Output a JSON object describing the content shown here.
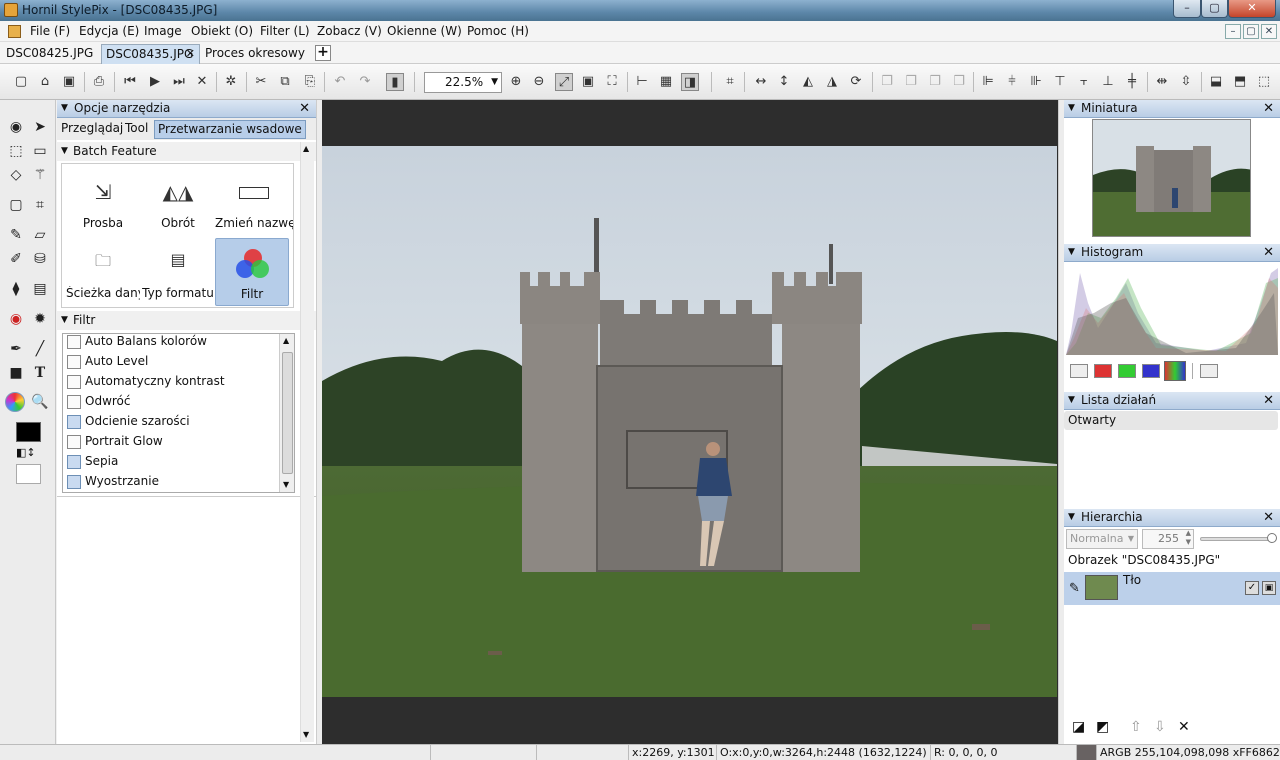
{
  "window": {
    "title": "Hornil StylePix - [DSC08435.JPG]",
    "buttons": [
      "–",
      "▢",
      "✕"
    ]
  },
  "menu": [
    "File (F)",
    "Edycja (E)",
    "Image",
    "Obiekt (O)",
    "Filter (L)",
    "Zobacz (V)",
    "Okienne (W)",
    "Pomoc (H)"
  ],
  "doc_tabs": [
    {
      "label": "DSC08425.JPG",
      "active": false
    },
    {
      "label": "DSC08435.JPG",
      "active": true,
      "close": "✕"
    },
    {
      "label": "Proces okresowy",
      "active": false
    }
  ],
  "add_tab": "+",
  "zoom": {
    "value": "22.5%"
  },
  "tool_options": {
    "title": "Opcje narzędzia",
    "close": "✕",
    "tabs": [
      {
        "label": "Przeglądaj",
        "active": false
      },
      {
        "label": "Tool",
        "active": false
      },
      {
        "label": "Przetwarzanie wsadowe",
        "active": true
      }
    ],
    "batch_header": "Batch Feature",
    "features": [
      {
        "label": "Prosba",
        "icon": "resize-icon",
        "selected": false
      },
      {
        "label": "Obrót",
        "icon": "rotate-icon",
        "selected": false
      },
      {
        "label": "Zmień nazwę",
        "icon": "rename-icon",
        "selected": false
      },
      {
        "label": "Ścieżka dany...",
        "icon": "folder-icon",
        "selected": false
      },
      {
        "label": "Typ formatu",
        "icon": "format-icon",
        "selected": false
      },
      {
        "label": "Filtr",
        "icon": "rgb-filter-icon",
        "selected": true
      }
    ],
    "filter_header": "Filtr",
    "filters": [
      {
        "label": "Auto Balans kolorów",
        "checked": false
      },
      {
        "label": "Auto Level",
        "checked": false
      },
      {
        "label": "Automatyczny kontrast",
        "checked": false
      },
      {
        "label": "Odwróć",
        "checked": false
      },
      {
        "label": "Odcienie szarości",
        "checked": true
      },
      {
        "label": "Portrait Glow",
        "checked": false
      },
      {
        "label": "Sepia",
        "checked": true
      },
      {
        "label": "Wyostrzanie",
        "checked": true
      }
    ]
  },
  "right": {
    "thumbnail": {
      "title": "Miniatura",
      "close": "✕"
    },
    "histogram": {
      "title": "Histogram",
      "close": "✕"
    },
    "actions": {
      "title": "Lista działań",
      "close": "✕",
      "items": [
        "Otwarty"
      ]
    },
    "hierarchy": {
      "title": "Hierarchia",
      "close": "✕",
      "blend_mode": "Normalna",
      "opacity": "255",
      "image_label": "Obrazek \"DSC08435.JPG\"",
      "layer_name": "Tło"
    }
  },
  "status": {
    "coords": "x:2269, y:1301",
    "geometry": "O:x:0,y:0,w:3264,h:2448 (1632,1224)",
    "rgba": "R: 0, 0, 0, 0",
    "argb": "ARGB 255,104,098,098 xFF686262"
  },
  "colors": {
    "accent": "#b8cee9",
    "panel_header": "#c8d8ec",
    "canvas_bg": "#2d2d2d",
    "foreground": "#000000",
    "background": "#ffffff"
  }
}
